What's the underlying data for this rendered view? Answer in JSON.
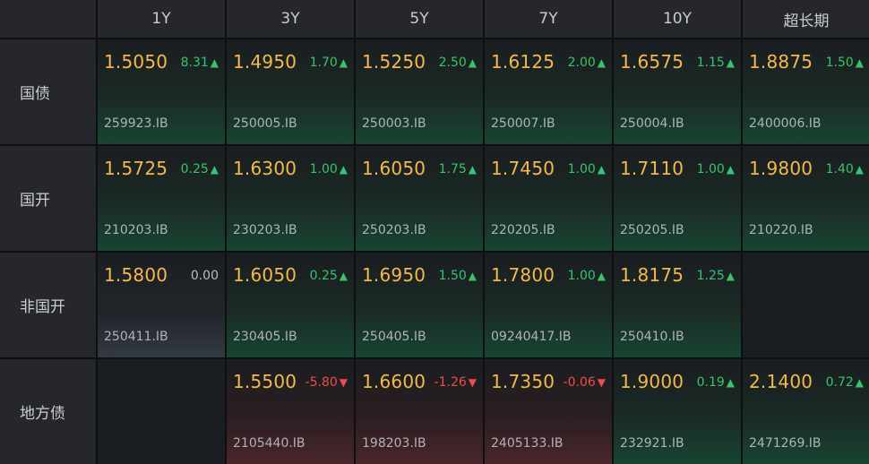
{
  "columns": [
    "1Y",
    "3Y",
    "5Y",
    "7Y",
    "10Y",
    "超长期"
  ],
  "rows": [
    {
      "label": "国债",
      "cells": [
        {
          "yield": "1.5050",
          "change": "8.31",
          "direction": "up",
          "code": "259923.IB"
        },
        {
          "yield": "1.4950",
          "change": "1.70",
          "direction": "up",
          "code": "250005.IB"
        },
        {
          "yield": "1.5250",
          "change": "2.50",
          "direction": "up",
          "code": "250003.IB"
        },
        {
          "yield": "1.6125",
          "change": "2.00",
          "direction": "up",
          "code": "250007.IB"
        },
        {
          "yield": "1.6575",
          "change": "1.15",
          "direction": "up",
          "code": "250004.IB"
        },
        {
          "yield": "1.8875",
          "change": "1.50",
          "direction": "up",
          "code": "2400006.IB"
        }
      ]
    },
    {
      "label": "国开",
      "cells": [
        {
          "yield": "1.5725",
          "change": "0.25",
          "direction": "up",
          "code": "210203.IB"
        },
        {
          "yield": "1.6300",
          "change": "1.00",
          "direction": "up",
          "code": "230203.IB"
        },
        {
          "yield": "1.6050",
          "change": "1.75",
          "direction": "up",
          "code": "250203.IB"
        },
        {
          "yield": "1.7450",
          "change": "1.00",
          "direction": "up",
          "code": "220205.IB"
        },
        {
          "yield": "1.7110",
          "change": "1.00",
          "direction": "up",
          "code": "250205.IB"
        },
        {
          "yield": "1.9800",
          "change": "1.40",
          "direction": "up",
          "code": "210220.IB"
        }
      ]
    },
    {
      "label": "非国开",
      "cells": [
        {
          "yield": "1.5800",
          "change": "0.00",
          "direction": "flat",
          "code": "250411.IB"
        },
        {
          "yield": "1.6050",
          "change": "0.25",
          "direction": "up",
          "code": "230405.IB"
        },
        {
          "yield": "1.6950",
          "change": "1.50",
          "direction": "up",
          "code": "250405.IB"
        },
        {
          "yield": "1.7800",
          "change": "1.00",
          "direction": "up",
          "code": "09240417.IB"
        },
        {
          "yield": "1.8175",
          "change": "1.25",
          "direction": "up",
          "code": "250410.IB"
        },
        null
      ]
    },
    {
      "label": "地方债",
      "cells": [
        null,
        {
          "yield": "1.5500",
          "change": "-5.80",
          "direction": "down",
          "code": "2105440.IB"
        },
        {
          "yield": "1.6600",
          "change": "-1.26",
          "direction": "down",
          "code": "198203.IB"
        },
        {
          "yield": "1.7350",
          "change": "-0.06",
          "direction": "down",
          "code": "2405133.IB"
        },
        {
          "yield": "1.9000",
          "change": "0.19",
          "direction": "up",
          "code": "232921.IB"
        },
        {
          "yield": "2.1400",
          "change": "0.72",
          "direction": "up",
          "code": "2471269.IB"
        }
      ]
    }
  ],
  "colors": {
    "yield": "#f5b84a",
    "up": "#37c46a",
    "down": "#f04a4a",
    "flat": "#b8bcc4"
  },
  "icons": {
    "up": "triangle-up-icon",
    "down": "triangle-down-icon"
  }
}
